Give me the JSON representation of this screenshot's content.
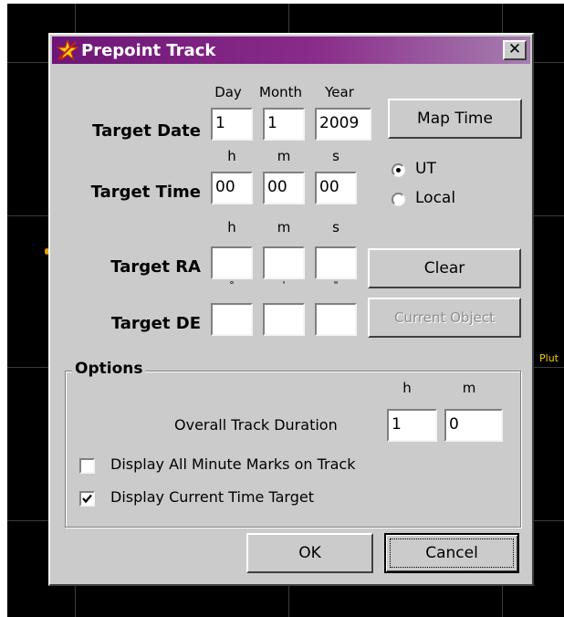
{
  "window": {
    "title": "Prepoint Track",
    "close_label": "✕"
  },
  "background": {
    "object_label": "Plut"
  },
  "columns": {
    "day": "Day",
    "month": "Month",
    "year": "Year",
    "h1": "h",
    "m1": "m",
    "s1": "s",
    "h2": "h",
    "m2": "m",
    "s2": "s"
  },
  "target_date": {
    "label": "Target Date",
    "day": "1",
    "month": "1",
    "year": "2009"
  },
  "target_time": {
    "label": "Target Time",
    "h": "00",
    "m": "00",
    "s": "00"
  },
  "time_mode": {
    "options": [
      "UT",
      "Local"
    ],
    "selected": "UT"
  },
  "target_ra": {
    "label": "Target RA",
    "h": "",
    "m": "",
    "s": ""
  },
  "target_de": {
    "label": "Target DE",
    "deg": "",
    "min": "",
    "sec": "",
    "unit_deg": "°",
    "unit_min": "'",
    "unit_sec": "\""
  },
  "buttons": {
    "map_time": "Map Time",
    "clear": "Clear",
    "current_object": "Current Object",
    "ok": "OK",
    "cancel": "Cancel"
  },
  "options": {
    "title": "Options",
    "duration_label": "Overall Track Duration",
    "duration_h_header": "h",
    "duration_m_header": "m",
    "duration_h": "1",
    "duration_m": "0",
    "display_minute_marks": {
      "label": "Display All Minute Marks on Track",
      "checked": false
    },
    "display_current_time": {
      "label": "Display Current Time Target",
      "checked": true
    }
  }
}
